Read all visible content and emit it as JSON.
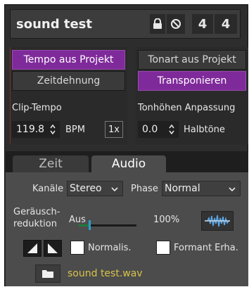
{
  "header": {
    "clip_name": "sound test",
    "time_signature": {
      "numerator": "4",
      "denominator": "4"
    }
  },
  "warp": {
    "tempo_from_project_label": "Tempo aus Projekt",
    "time_stretch_label": "Zeitdehnung",
    "clip_tempo_label": "Clip-Tempo",
    "clip_tempo_value": "119.8",
    "bpm_label": "BPM",
    "speed_label": "1x"
  },
  "pitch": {
    "key_from_project_label": "Tonart aus Projekt",
    "transpose_label": "Transponieren",
    "pitch_adjust_label": "Tonhöhen Anpassung",
    "semitones_value": "0.0",
    "semitones_label": "Halbtöne"
  },
  "tabs": [
    {
      "label": "Zeit",
      "active": false
    },
    {
      "label": "Audio",
      "active": true
    }
  ],
  "audio": {
    "channels_label": "Kanäle",
    "channels_value": "Stereo",
    "phase_label": "Phase",
    "phase_value": "Normal",
    "denoise_label_line1": "Geräusch-",
    "denoise_label_line2": "reduktion",
    "denoise_off_label": "Aus",
    "denoise_max_label": "100%",
    "denoise_level": 0.18,
    "normalize_label": "Normalis.",
    "normalize_checked": false,
    "formant_label": "Formant Erha.",
    "formant_checked": false,
    "file_name": "sound test.wav"
  },
  "colors": {
    "accent": "#7f2a9a",
    "file_text": "#d8c24a",
    "slider_thumb": "#2aa0c8",
    "slider_fill": "#1e7a3c"
  },
  "icons": {
    "lock": "lock-icon",
    "deactivate": "deactivate-icon",
    "waveform": "waveform-icon",
    "folder": "folder-icon"
  }
}
